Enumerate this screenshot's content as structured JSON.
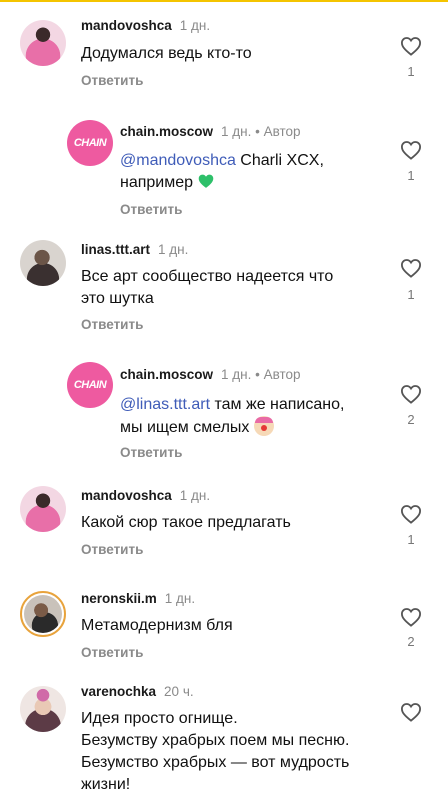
{
  "comments": [
    {
      "user": "mandovoshca",
      "time": "1 дн.",
      "text_lines": [
        "Додумался ведь кто-то"
      ],
      "reply_label": "Ответить",
      "likes": "1"
    },
    {
      "user": "chain.moscow",
      "time": "1 дн.",
      "author_label": "• Автор",
      "mention": "@mandovoshca",
      "text_after_mention": " Charli XCX,",
      "text_line2": "например",
      "emoji": "green-heart",
      "reply_label": "Ответить",
      "likes": "1"
    },
    {
      "user": "linas.ttt.art",
      "time": "1 дн.",
      "text_lines": [
        "Все арт сообщество надеется что",
        "это шутка"
      ],
      "reply_label": "Ответить",
      "likes": "1"
    },
    {
      "user": "chain.moscow",
      "time": "1 дн.",
      "author_label": "• Автор",
      "mention": "@linas.ttt.art",
      "text_after_mention": " там же написано,",
      "text_line2": "мы ищем смелых",
      "emoji": "clown-face",
      "reply_label": "Ответить",
      "likes": "2"
    },
    {
      "user": "mandovoshca",
      "time": "1 дн.",
      "text_lines": [
        "Какой сюр такое предлагать"
      ],
      "reply_label": "Ответить",
      "likes": "1"
    },
    {
      "user": "neronskii.m",
      "time": "1 дн.",
      "text_lines": [
        "Метамодернизм бля"
      ],
      "reply_label": "Ответить",
      "likes": "2"
    },
    {
      "user": "varenochka",
      "time": "20 ч.",
      "text_lines": [
        "Идея просто огнище.",
        "Безумству храбрых поем мы песню.",
        "Безумство храбрых — вот мудрость",
        "жизни!"
      ]
    }
  ],
  "avatar_logo_text": "CHAIN",
  "colors": {
    "mention": "#3f5cb8",
    "muted": "#8a8a8a",
    "chain_brand": "#ee5aa0",
    "story_ring": "#e8a33c"
  },
  "icons": {
    "like": "heart-outline-icon"
  }
}
